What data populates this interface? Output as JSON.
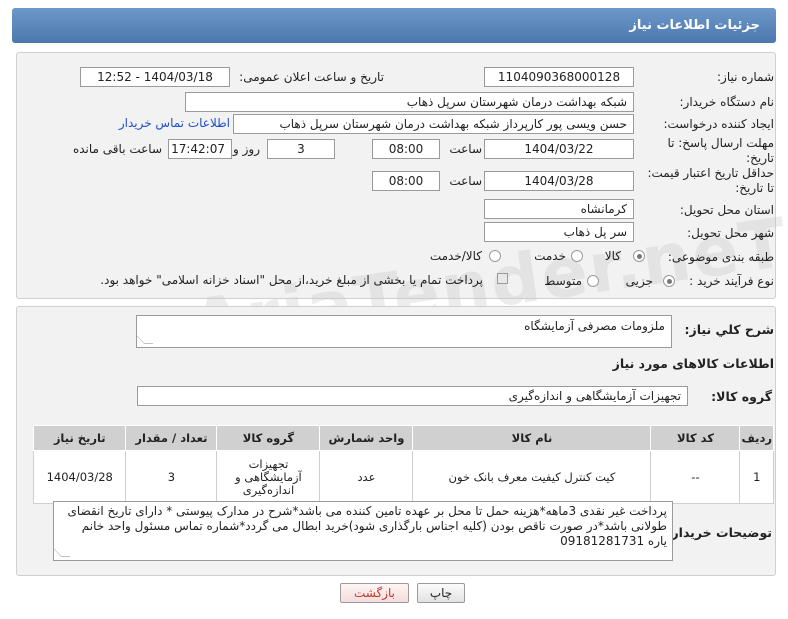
{
  "header": {
    "title": "جزئیات اطلاعات نیاز"
  },
  "labels": {
    "need_number": "شماره نیاز:",
    "announce_datetime": "تاریخ و ساعت اعلان عمومی:",
    "buyer_org": "نام دستگاه خریدار:",
    "requester": "ایجاد کننده درخواست:",
    "reply_deadline": "مهلت ارسال پاسخ: تا تاریخ:",
    "price_validity": "حداقل تاریخ اعتبار قیمت: تا تاریخ:",
    "time": "ساعت",
    "days_and": "روز و",
    "hours_remaining": "ساعت باقی مانده",
    "province": "استان محل تحویل:",
    "city": "شهر محل تحویل:",
    "category": "طبقه بندی موضوعی:",
    "purchase_type": "نوع فرآیند خرید :",
    "general_desc": "شرح کلي نياز:",
    "items_section": "اطلاعات کالاهای مورد نیاز",
    "goods_group": "گروه کالا:",
    "buyer_notes": "توضیحات خریدار:"
  },
  "values": {
    "need_number": "1104090368000128",
    "announce_datetime": "1404/03/18 - 12:52",
    "buyer_org": "شبکه بهداشت درمان شهرستان سرپل ذهاب",
    "requester": "حسن ویسی پور کارپرداز شبکه بهداشت درمان شهرستان سرپل ذهاب",
    "contact_link": "اطلاعات تماس خریدار",
    "reply_date": "1404/03/22",
    "reply_time": "08:00",
    "days": "3",
    "remaining": "17:42:07",
    "validity_date": "1404/03/28",
    "validity_time": "08:00",
    "province": "کرمانشاه",
    "city": "سر پل ذهاب",
    "general_desc": "ملزومات مصرفی آزمایشگاه",
    "goods_group": "تجهیزات آزمایشگاهی و اندازه‌گیری",
    "buyer_notes": "پرداخت غیر نقدی 3ماهه*هزینه حمل تا محل بر عهده تامین کننده می باشد*شرح در مدارک پیوستی * دارای تاریخ انقضای طولانی باشد*در صورت ناقص بودن (کلیه اجناس بارگذاری شود)خرید ابطال می گردد*شماره تماس مسئول واحد خانم یاره 09181281731"
  },
  "category_options": [
    "کالا",
    "خدمت",
    "کالا/خدمت"
  ],
  "purchase_options": [
    "جزیی",
    "متوسط"
  ],
  "payment_note": "پرداخت تمام یا بخشی از مبلغ خرید،از محل \"اسناد خزانه اسلامی\" خواهد بود.",
  "table": {
    "headers": [
      "ردیف",
      "کد کالا",
      "نام کالا",
      "واحد شمارش",
      "گروه کالا",
      "تعداد / مقدار",
      "تاریخ نیاز"
    ],
    "rows": [
      [
        "1",
        "--",
        "کیت کنترل کیفیت معرف بانک خون",
        "عدد",
        "تجهیزات آزمایشگاهی و اندازه‌گیری",
        "3",
        "1404/03/28"
      ]
    ]
  },
  "buttons": {
    "print": "چاپ",
    "back": "بازگشت"
  },
  "watermark": "AriaTender.neT"
}
